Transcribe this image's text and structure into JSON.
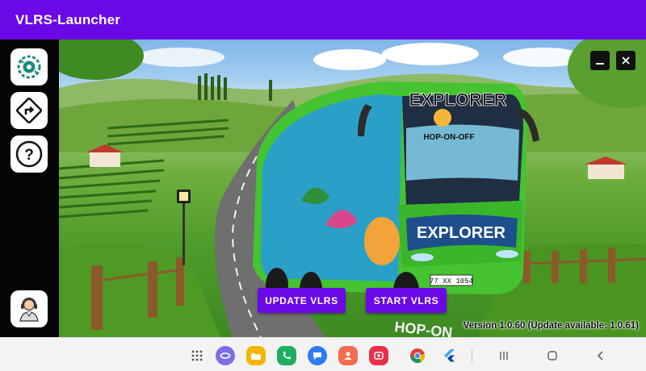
{
  "app": {
    "title": "VLRS-Launcher"
  },
  "sidebar": {
    "items": [
      {
        "name": "settings",
        "icon": "gear-bug-icon"
      },
      {
        "name": "route",
        "icon": "route-sign-icon"
      },
      {
        "name": "help",
        "icon": "question-icon",
        "glyph": "?"
      },
      {
        "name": "support",
        "icon": "headset-agent-icon"
      }
    ]
  },
  "banner": {
    "bus_title": "EXPLORER",
    "bus_subtitle": "HOP-ON-OFF",
    "bus_side": "EXPLORER",
    "plate": "77 XX 1054",
    "road_text": "HOP-ON"
  },
  "actions": {
    "update_label": "UPDATE VLRS",
    "start_label": "START VLRS"
  },
  "version_text": "Version 1.0.60 (Update available: 1.0.61)",
  "taskbar": {
    "apps": [
      "apps-grid-icon",
      "browser-icon",
      "files-icon",
      "phone-icon",
      "messages-icon",
      "contacts-icon",
      "screen-recorder-icon",
      "chrome-icon",
      "flutter-icon"
    ]
  },
  "colors": {
    "accent": "#6b08e6",
    "sidebar": "#050505"
  }
}
